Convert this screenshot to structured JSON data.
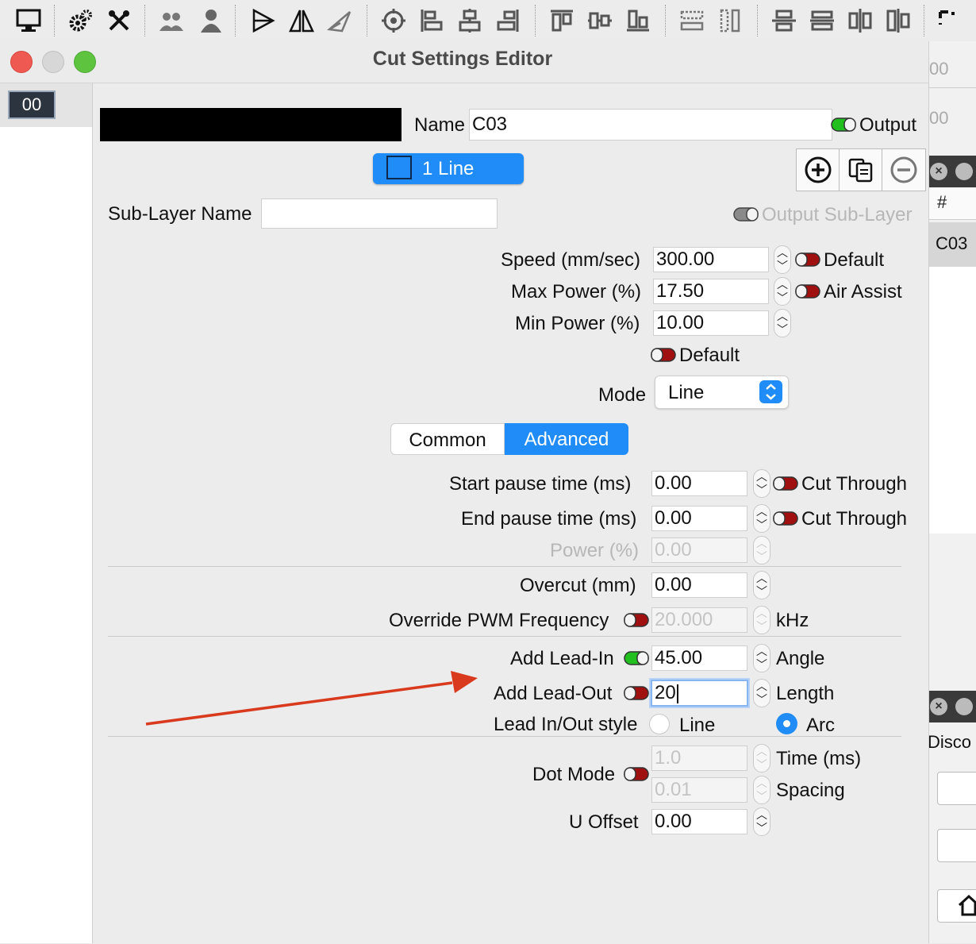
{
  "toolbar": {
    "icons": [
      "monitor-icon",
      "gears-icon",
      "tools-icon",
      "users-icon",
      "user-icon",
      "mirror-horizontal-icon",
      "mirror-vertical-icon",
      "rotate-icon",
      "target-icon",
      "align-left-icon",
      "align-center-icon",
      "align-right-icon",
      "align-top-icon",
      "align-middle-icon",
      "align-bottom-icon",
      "distribute-h-icon",
      "distribute-v-icon",
      "space-h-icon",
      "space-v-icon",
      "center-v-icon",
      "center-h-icon",
      "more-icon"
    ]
  },
  "left": {
    "layer_chip": "00"
  },
  "right": {
    "top_value_1": "00",
    "top_value_2": "00",
    "col_header": "#",
    "row_value": "C03",
    "panel_label": "Disco"
  },
  "dialog": {
    "title": "Cut Settings Editor",
    "name_label": "Name",
    "name_value": "C03",
    "output_label": "Output",
    "sublayer_button": "1 Line",
    "sublayer_name_label": "Sub-Layer Name",
    "sublayer_name_value": "",
    "output_sublayer_label": "Output Sub-Layer",
    "speed_label": "Speed (mm/sec)",
    "speed_value": "300.00",
    "speed_default_label": "Default",
    "max_power_label": "Max Power (%)",
    "max_power_value": "17.50",
    "air_assist_label": "Air Assist",
    "min_power_label": "Min Power (%)",
    "min_power_value": "10.00",
    "power_default_label": "Default",
    "mode_label": "Mode",
    "mode_value": "Line",
    "tabs": {
      "common": "Common",
      "advanced": "Advanced"
    },
    "start_pause_label": "Start pause time (ms)",
    "start_pause_value": "0.00",
    "start_cut_through_label": "Cut Through",
    "end_pause_label": "End pause time (ms)",
    "end_pause_value": "0.00",
    "end_cut_through_label": "Cut Through",
    "power_label": "Power (%)",
    "power_value": "0.00",
    "overcut_label": "Overcut (mm)",
    "overcut_value": "0.00",
    "pwm_label": "Override PWM Frequency",
    "pwm_value": "20.000",
    "pwm_unit": "kHz",
    "lead_in_label": "Add Lead-In",
    "lead_in_value": "45.00",
    "lead_in_unit": "Angle",
    "lead_out_label": "Add Lead-Out",
    "lead_out_value": "20",
    "lead_out_unit": "Length",
    "lead_style_label": "Lead In/Out style",
    "lead_style_line": "Line",
    "lead_style_arc": "Arc",
    "dot_mode_label": "Dot Mode",
    "dot_time_value": "1.0",
    "dot_time_unit": "Time (ms)",
    "dot_spacing_value": "0.01",
    "dot_spacing_unit": "Spacing",
    "u_offset_label": "U Offset",
    "u_offset_value": "0.00"
  },
  "colors": {
    "accent": "#1f8cf7",
    "toggle_on": "#22c01e",
    "toggle_off": "#a01010",
    "arrow": "#d93a1e",
    "layer_swatch": "#000000"
  }
}
